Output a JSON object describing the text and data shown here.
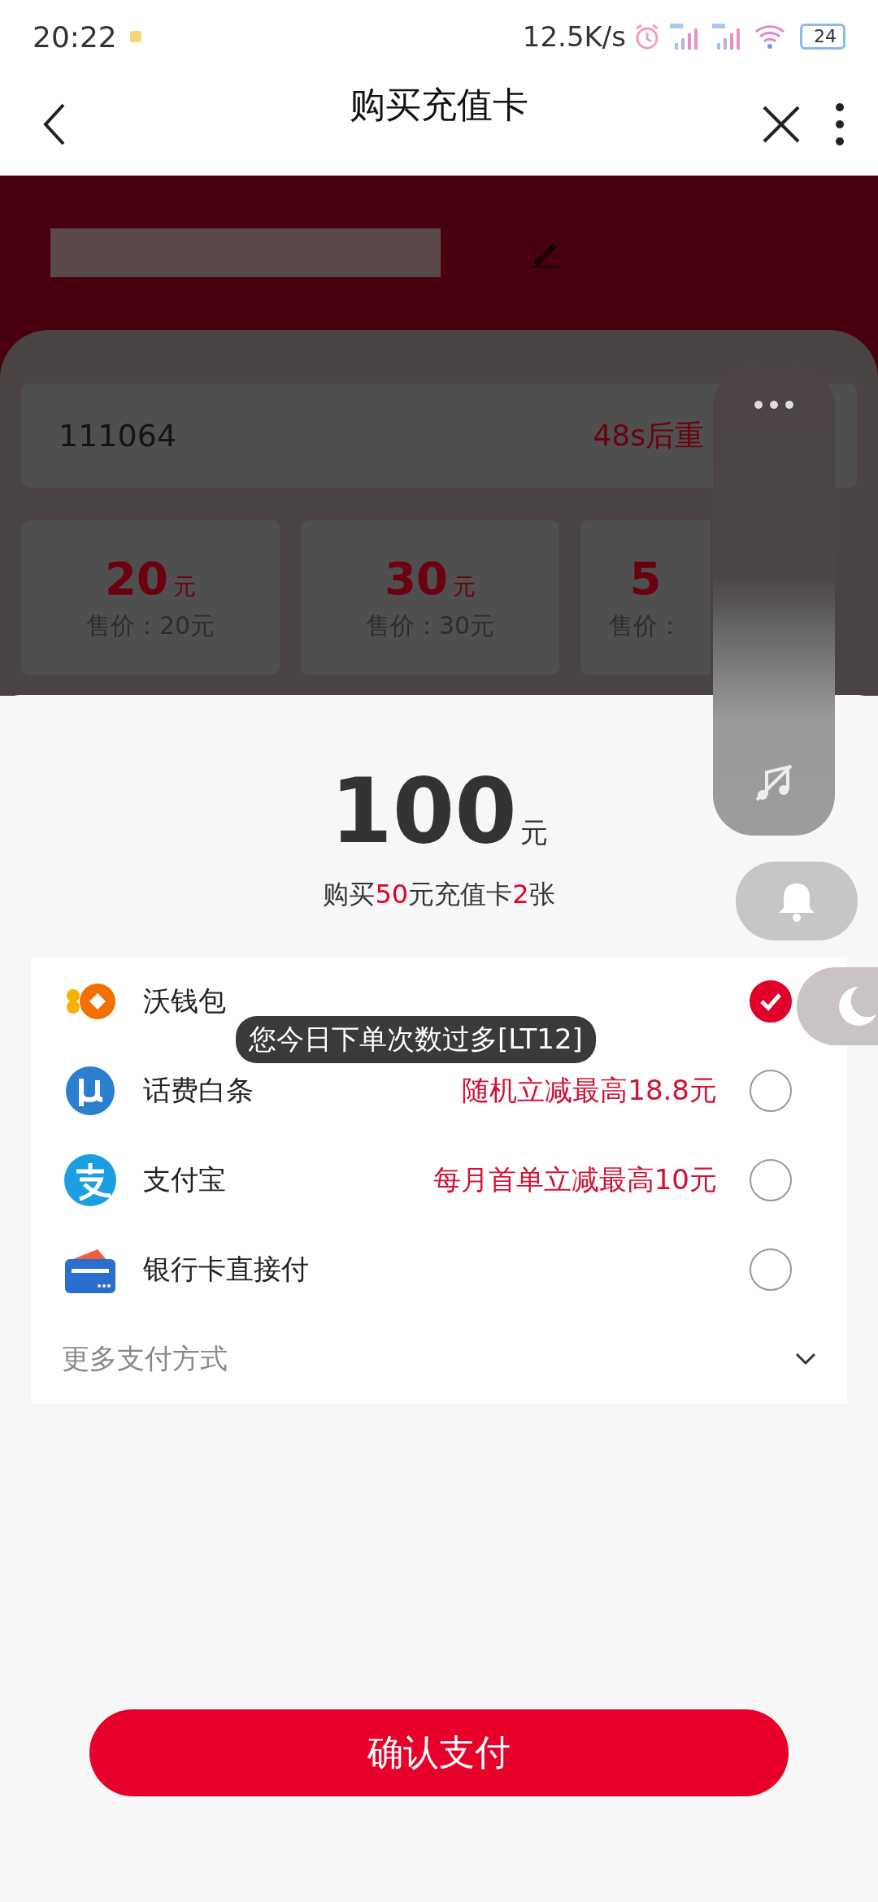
{
  "status_bar": {
    "time": "20:22",
    "network_speed": "12.5K/s",
    "battery": "24"
  },
  "header": {
    "title": "购买充值卡"
  },
  "phone_field": {
    "value": "111064",
    "resend": "48s后重"
  },
  "cards": [
    {
      "amount": "20",
      "unit": "元",
      "price": "售价：20元"
    },
    {
      "amount": "30",
      "unit": "元",
      "price": "售价：30元"
    },
    {
      "amount": "5",
      "price": "售价："
    }
  ],
  "sheet": {
    "total": "100",
    "unit": "元",
    "summary": [
      {
        "text": "购买",
        "highlight": false
      },
      {
        "text": "50",
        "highlight": true
      },
      {
        "text": "元充值卡",
        "highlight": false
      },
      {
        "text": "2",
        "highlight": true
      },
      {
        "text": "张",
        "highlight": false
      }
    ]
  },
  "payment_methods": [
    {
      "kind": "wallet",
      "name": "沃钱包",
      "selected": true
    },
    {
      "kind": "credit",
      "name": "话费白条",
      "promo": "随机立减最高18.8元",
      "selected": false
    },
    {
      "kind": "alipay",
      "name": "支付宝",
      "promo": "每月首单立减最高10元",
      "selected": false
    },
    {
      "kind": "bank",
      "name": "银行卡直接付",
      "selected": false
    }
  ],
  "more_methods": "更多支付方式",
  "toast": "您今日下单次数过多[LT12]",
  "confirm_button": "确认支付"
}
